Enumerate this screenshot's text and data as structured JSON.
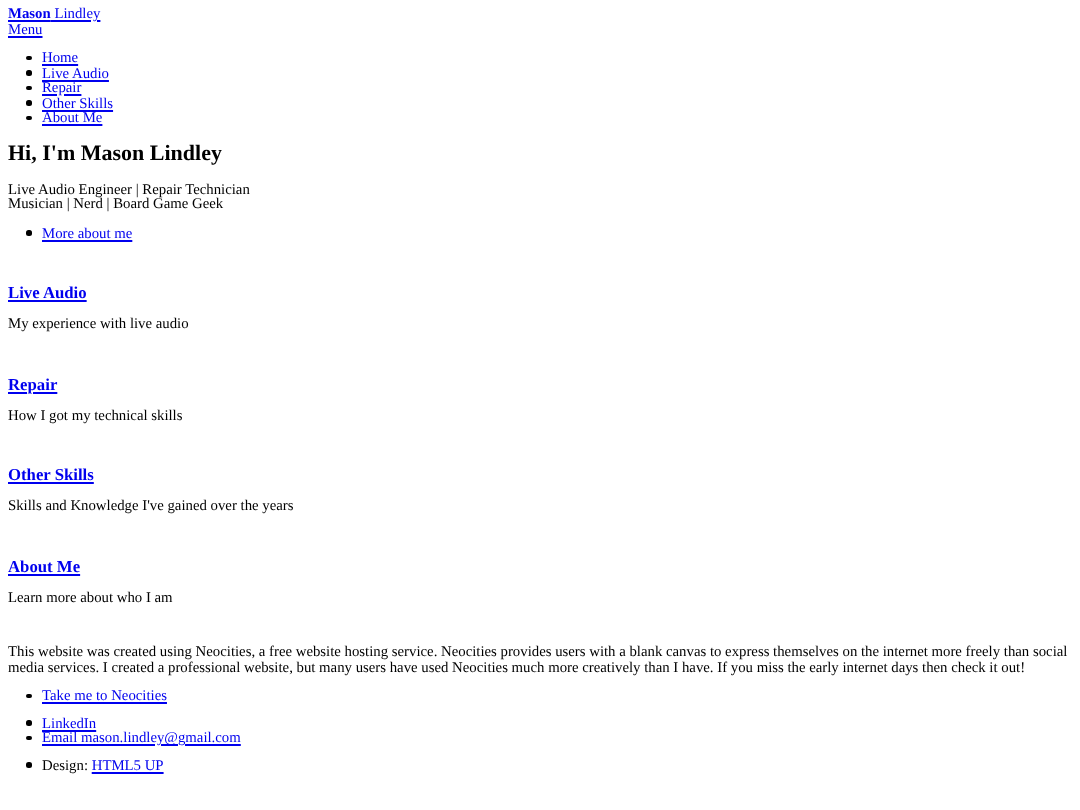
{
  "header": {
    "logo": "**Mason** Lindley",
    "menu_link": "Menu",
    "nav": [
      "Home",
      "Live Audio",
      "Repair",
      "Other Skills",
      "About Me"
    ]
  },
  "intro": {
    "heading": "Hi, I'm Mason Lindley",
    "lines": [
      "Live Audio Engineer | Repair Technician",
      "Musician | Nerd | Board Game Geek"
    ],
    "links": [
      "More about me"
    ]
  },
  "sections": [
    {
      "title": "Live Audio",
      "description": "My experience with live audio"
    },
    {
      "title": "Repair",
      "description": "How I got my technical skills"
    },
    {
      "title": "Other Skills",
      "description": "Skills and Knowledge I've gained over the years"
    },
    {
      "title": "About Me",
      "description": "Learn more about who I am"
    }
  ],
  "footer": {
    "paragraph": "This website was created using Neocities, a free website hosting service. Neocities provides users with a blank canvas to express themselves on the internet more freely than social media services. I created a professional website, but many users have used Neocities much more creatively than I have. If you miss the early internet days then check it out!",
    "link_groups": [
      [
        "Take me to Neocities"
      ],
      [
        "LinkedIn",
        "Email mason.lindley@gmail.com"
      ]
    ],
    "credit": {
      "label": "Design:",
      "link": "HTML5 UP"
    }
  }
}
